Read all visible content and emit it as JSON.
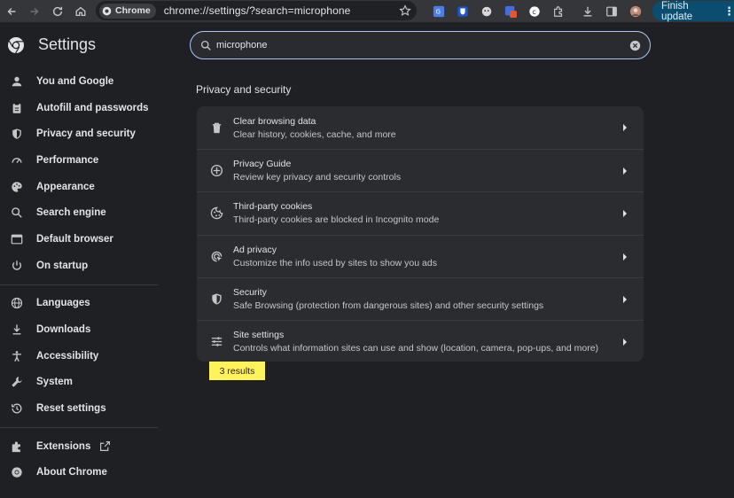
{
  "browser": {
    "chip_label": "Chrome",
    "url": "chrome://settings/?search=microphone",
    "finish_update_label": "Finish update"
  },
  "app": {
    "title": "Settings"
  },
  "search": {
    "value": "microphone"
  },
  "sidebar": {
    "items": [
      {
        "label": "You and Google",
        "icon": "person-icon"
      },
      {
        "label": "Autofill and passwords",
        "icon": "clipboard-icon"
      },
      {
        "label": "Privacy and security",
        "icon": "shield-icon"
      },
      {
        "label": "Performance",
        "icon": "speedometer-icon"
      },
      {
        "label": "Appearance",
        "icon": "palette-icon"
      },
      {
        "label": "Search engine",
        "icon": "search-icon"
      },
      {
        "label": "Default browser",
        "icon": "browser-window-icon"
      },
      {
        "label": "On startup",
        "icon": "power-icon"
      },
      {
        "label": "Languages",
        "icon": "globe-icon"
      },
      {
        "label": "Downloads",
        "icon": "download-icon"
      },
      {
        "label": "Accessibility",
        "icon": "accessibility-icon"
      },
      {
        "label": "System",
        "icon": "wrench-icon"
      },
      {
        "label": "Reset settings",
        "icon": "history-icon"
      },
      {
        "label": "Extensions",
        "icon": "puzzle-icon"
      },
      {
        "label": "About Chrome",
        "icon": "chrome-icon"
      }
    ]
  },
  "main": {
    "section_title": "Privacy and security",
    "rows": [
      {
        "title": "Clear browsing data",
        "subtitle": "Clear history, cookies, cache, and more",
        "icon": "trash-icon"
      },
      {
        "title": "Privacy Guide",
        "subtitle": "Review key privacy and security controls",
        "icon": "compass-icon"
      },
      {
        "title": "Third-party cookies",
        "subtitle": "Third-party cookies are blocked in Incognito mode",
        "icon": "cookie-icon"
      },
      {
        "title": "Ad privacy",
        "subtitle": "Customize the info used by sites to show you ads",
        "icon": "ad-target-icon"
      },
      {
        "title": "Security",
        "subtitle": "Safe Browsing (protection from dangerous sites) and other security settings",
        "icon": "shield-icon"
      },
      {
        "title": "Site settings",
        "subtitle": "Controls what information sites can use and show (location, camera, pop-ups, and more)",
        "icon": "sliders-icon"
      }
    ],
    "results_badge": "3 results"
  },
  "colors": {
    "background": "#1f2024",
    "card": "#2b2c30",
    "accent": "#a8c7fa",
    "highlight": "#fff35a",
    "update_button": "#0b4d6e"
  }
}
